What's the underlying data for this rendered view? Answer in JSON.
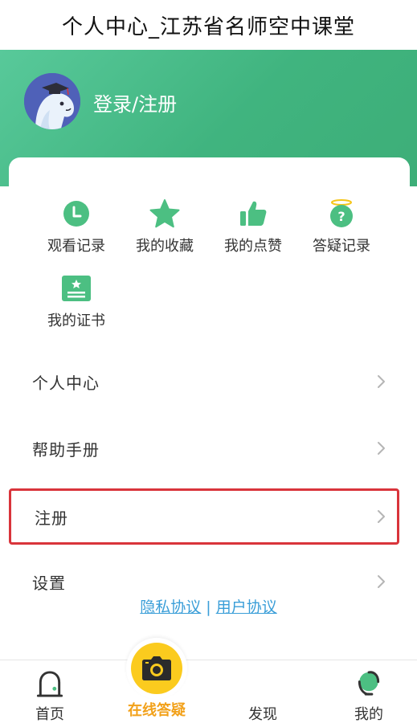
{
  "window": {
    "title": "个人中心_江苏省名师空中课堂"
  },
  "header": {
    "login_label": "登录/注册"
  },
  "quick_actions": [
    {
      "label": "观看记录",
      "icon": "clock-icon"
    },
    {
      "label": "我的收藏",
      "icon": "star-icon"
    },
    {
      "label": "我的点赞",
      "icon": "thumbs-up-icon"
    },
    {
      "label": "答疑记录",
      "icon": "question-badge-icon"
    },
    {
      "label": "我的证书",
      "icon": "certificate-icon"
    }
  ],
  "menu": [
    {
      "label": "个人中心"
    },
    {
      "label": "帮助手册"
    },
    {
      "label": "注册",
      "highlighted": true
    },
    {
      "label": "设置"
    }
  ],
  "footer_links": {
    "privacy": "隐私协议",
    "separator": "|",
    "terms": "用户协议"
  },
  "tabs": [
    {
      "label": "首页",
      "icon": "home-icon"
    },
    {
      "label": "在线答疑",
      "icon": "camera-icon"
    },
    {
      "label": "发现",
      "icon": ""
    },
    {
      "label": "我的",
      "icon": "profile-icon"
    }
  ],
  "colors": {
    "header_green": "#40b47f",
    "icon_green": "#4cbf82",
    "accent_orange": "#f2a11a",
    "highlight_red": "#d9343b",
    "link_blue": "#3a9ed8"
  }
}
